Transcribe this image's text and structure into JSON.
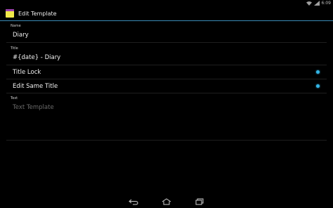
{
  "status_bar": {
    "time": "6:09"
  },
  "action_bar": {
    "title": "Edit Template"
  },
  "form": {
    "name": {
      "label": "Name",
      "value": "Diary"
    },
    "title": {
      "label": "Title",
      "value": "#{date} - Diary"
    },
    "title_lock": {
      "label": "Title Lock",
      "checked": true
    },
    "edit_same_title": {
      "label": "Edit Same Title",
      "checked": true
    },
    "text": {
      "label": "Text",
      "placeholder": "Text Template"
    }
  },
  "colors": {
    "accent": "#33b5e5",
    "app_icon_yellow": "#f2e94a",
    "app_icon_purple": "#9b3fb0"
  },
  "icons": [
    "app-icon",
    "wifi-icon",
    "signal-icon",
    "back-icon",
    "home-icon",
    "recent-apps-icon"
  ]
}
